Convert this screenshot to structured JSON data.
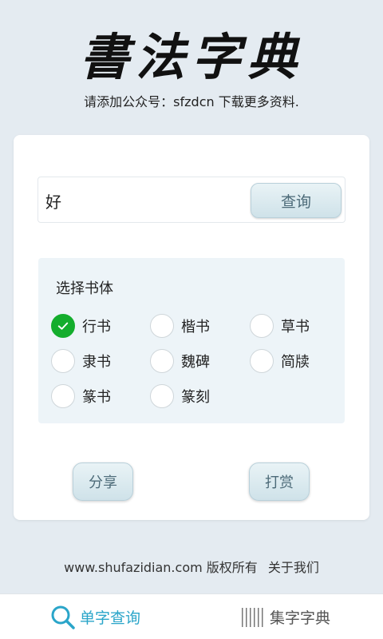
{
  "app": {
    "title": "書法字典",
    "subtitle": "请添加公众号：sfzdcn 下载更多资料."
  },
  "search": {
    "value": "好",
    "button_label": "查询"
  },
  "font_panel": {
    "title": "选择书体",
    "options": [
      {
        "label": "行书",
        "checked": true
      },
      {
        "label": "楷书",
        "checked": false
      },
      {
        "label": "草书",
        "checked": false
      },
      {
        "label": "隶书",
        "checked": false
      },
      {
        "label": "魏碑",
        "checked": false
      },
      {
        "label": "简牍",
        "checked": false
      },
      {
        "label": "篆书",
        "checked": false
      },
      {
        "label": "篆刻",
        "checked": false
      }
    ]
  },
  "actions": {
    "share_label": "分享",
    "tip_label": "打赏"
  },
  "footer": {
    "copyright": "www.shufazidian.com 版权所有",
    "about": "关于我们"
  },
  "nav": {
    "single_char": "单字查询",
    "collect_char": "集字字典"
  },
  "colors": {
    "accent": "#2aa5c9",
    "checked": "#14ad2d",
    "button_text": "#4c6a78"
  },
  "icons": {
    "check": "check-icon",
    "search": "search-icon",
    "barcode": "barcode-icon"
  }
}
